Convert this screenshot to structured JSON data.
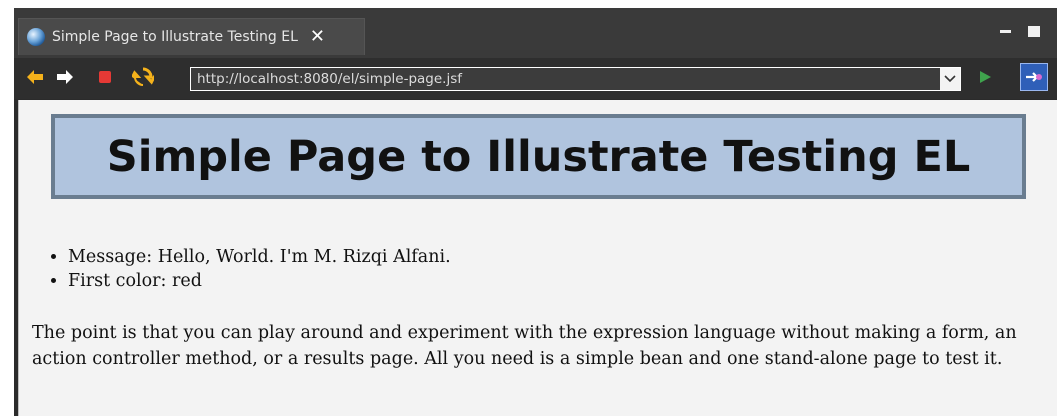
{
  "tab": {
    "title": "Simple Page to Illustrate Testing EL",
    "close": "✕"
  },
  "window_controls": {
    "minimize": "minimize-icon",
    "maximize": "maximize-icon"
  },
  "toolbar": {
    "back": "back-arrow-icon",
    "forward": "forward-arrow-icon",
    "stop": "stop-icon",
    "refresh": "refresh-icon",
    "url": "http://localhost:8080/el/simple-page.jsf",
    "go": "go-play-icon",
    "open_external": "open-external-icon"
  },
  "page": {
    "heading": "Simple Page to Illustrate Testing EL",
    "items": [
      "Message: Hello, World. I'm M. Rizqi Alfani.",
      "First color: red"
    ],
    "paragraph": "The point is that you can play around and experiment with the expression language without making a form, an action controller method, or a results page. All you need is a simple bean and one stand-alone page to test it."
  },
  "colors": {
    "header_bg": "#b0c4de",
    "header_border": "#6a7d90",
    "chrome_bg": "#2b2b2b",
    "content_bg": "#f3f3f3"
  }
}
